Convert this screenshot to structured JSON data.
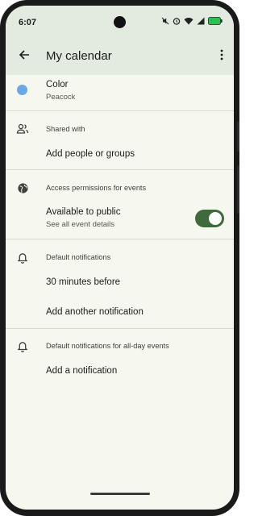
{
  "status_bar": {
    "time": "6:07",
    "icons": [
      "mute-icon",
      "alarm-icon",
      "wifi-icon",
      "signal-icon",
      "battery-icon"
    ]
  },
  "app_bar": {
    "title": "My calendar",
    "back_icon": "arrow-back-icon",
    "menu_icon": "more-vert-icon"
  },
  "color": {
    "label": "Color",
    "value": "Peacock",
    "swatch": "#6aa7e6"
  },
  "shared_with": {
    "header": "Shared with",
    "icon": "people-icon",
    "action": "Add people or groups"
  },
  "access": {
    "header": "Access permissions for events",
    "icon": "globe-icon",
    "public_label": "Available to public",
    "public_sub": "See all event details",
    "public_enabled": true
  },
  "default_notifications": {
    "header": "Default notifications",
    "icon": "bell-icon",
    "items": [
      "30 minutes before"
    ],
    "add_label": "Add another notification"
  },
  "all_day_notifications": {
    "header": "Default notifications for all-day events",
    "icon": "bell-icon",
    "add_label": "Add a notification"
  },
  "colors": {
    "accent": "#3e6a3c",
    "background": "#f6f7ef",
    "header_bg": "#e3eadf"
  }
}
